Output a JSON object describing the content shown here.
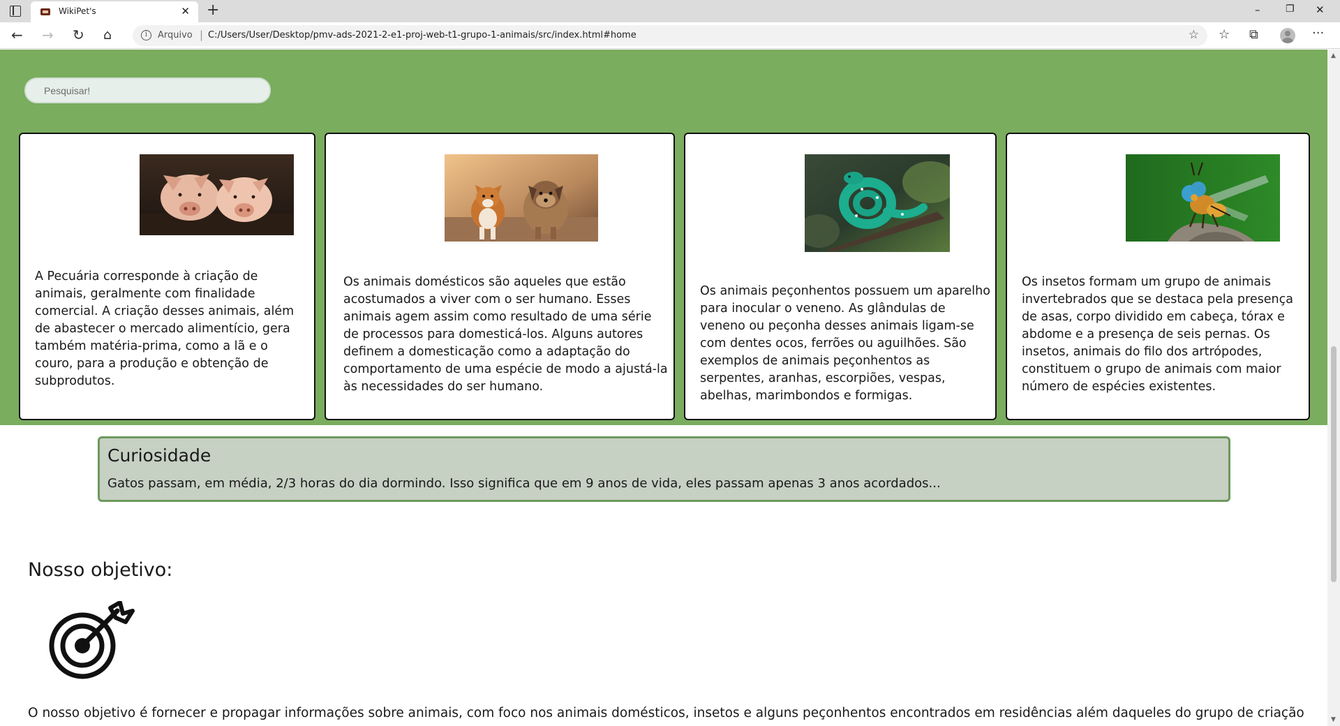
{
  "browser": {
    "tab_title": "WikiPet's",
    "tab_close": "✕",
    "new_tab": "+",
    "win_min": "–",
    "win_max": "❐",
    "win_close": "✕",
    "back": "←",
    "forward": "→",
    "reload": "↻",
    "home": "⌂",
    "info_symbol": "i",
    "url_prefix": "Arquivo",
    "url_sep": "|",
    "url": "C:/Users/User/Desktop/pmv-ads-2021-2-e1-proj-web-t1-grupo-1-animais/src/index.html#home",
    "star": "☆",
    "favorites": "☆",
    "collections": "⧉",
    "more": "···"
  },
  "search": {
    "placeholder": "Pesquisar!"
  },
  "cards": [
    {
      "image": "pigs",
      "text": "A Pecuária corresponde à criação de animais, geralmente com finalidade comercial. A criação desses animais, além de abastecer o mercado alimentício, gera também matéria-prima, como a lã e o couro, para a produção e obtenção de subprodutos."
    },
    {
      "image": "dogs",
      "text": "Os animais domésticos são aqueles que estão acostumados a viver com o ser humano. Esses animais agem assim como resultado de uma série de processos para domesticá-los. Alguns autores definem a domesticação como a adaptação do comportamento de uma espécie de modo a ajustá-la às necessidades do ser humano."
    },
    {
      "image": "green-snake",
      "text": "Os animais peçonhentos possuem um aparelho para inocular o veneno. As glândulas de veneno ou peçonha desses animais ligam-se com dentes ocos, ferrões ou aguilhões. São exemplos de animais peçonhentos as serpentes, aranhas, escorpiões, vespas, abelhas, marimbondos e formigas."
    },
    {
      "image": "fly-insect",
      "text": "Os insetos formam um grupo de animais invertebrados que se destaca pela presença de asas, corpo dividido em cabeça, tórax e abdome e a presença de seis pernas. Os insetos, animais do filo dos artrópodes, constituem o grupo de animais com maior número de espécies existentes."
    }
  ],
  "curiosity": {
    "title": "Curiosidade",
    "text": "Gatos passam, em média, 2/3 horas do dia dormindo. Isso significa que em 9 anos de vida, eles passam apenas 3 anos acordados..."
  },
  "objective": {
    "title": "Nosso objetivo:",
    "icon": "target-icon",
    "text": "O nosso objetivo é fornecer e propagar informações sobre animais, com foco nos animais domésticos, insetos e alguns peçonhentos encontrados em residências além daqueles do grupo de criação em cativeiro. Como"
  },
  "colors": {
    "page_green": "#7aad5e",
    "curiosity_bg": "#c6d0c3",
    "curiosity_border": "#6d9a5d"
  }
}
